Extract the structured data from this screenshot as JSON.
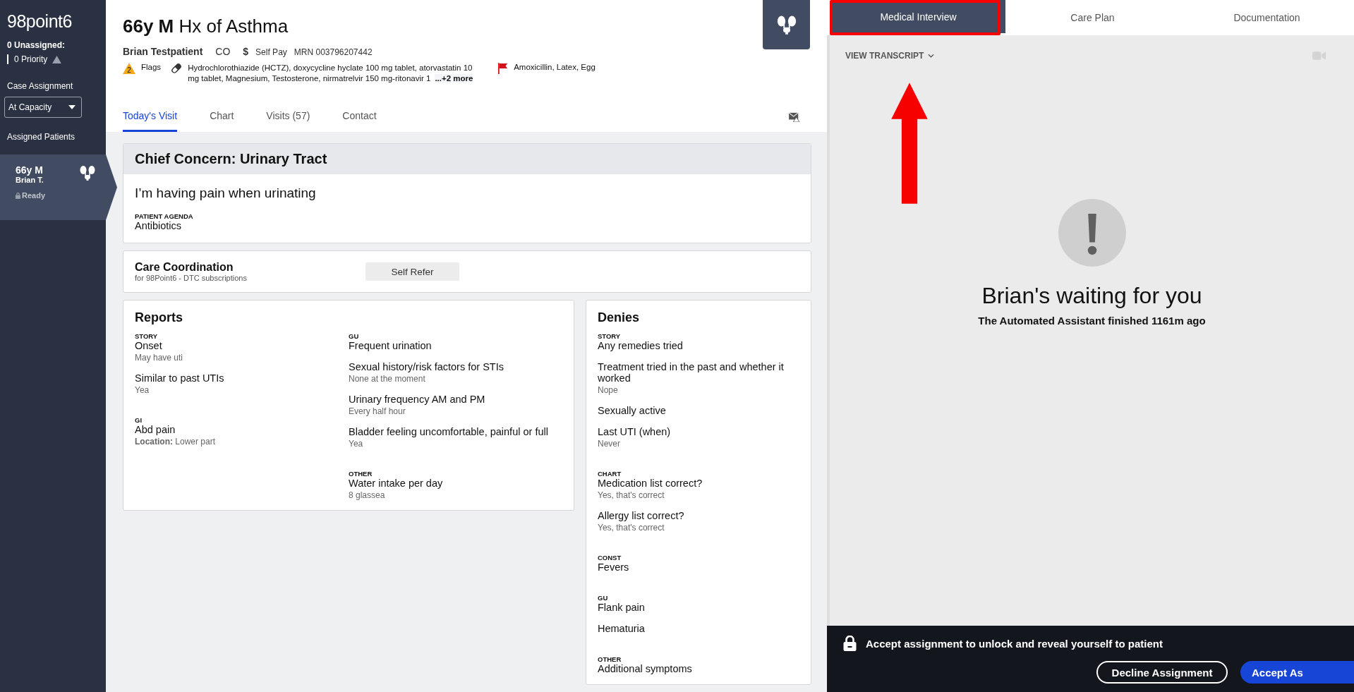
{
  "sidebar": {
    "logo": "98point6",
    "unassigned": "0 Unassigned:",
    "priority": "0 Priority",
    "case_assignment_label": "Case Assignment",
    "case_assignment_value": "At Capacity",
    "assigned_label": "Assigned Patients",
    "patients": [
      {
        "title": "66y M",
        "name": "Brian T.",
        "status": "Ready",
        "selected": true
      }
    ]
  },
  "header": {
    "title_bold": "66y M",
    "title_rest": "Hx of Asthma",
    "patient_name": "Brian Testpatient",
    "state": "CO",
    "payment_symbol": "$",
    "payment": "Self Pay",
    "mrn": "MRN 003796207442",
    "flags_count": "2",
    "flags_label": "Flags",
    "medications": "Hydrochlorothiazide (HCTZ), doxycycline hyclate 100 mg tablet, atorvastatin 10 mg tablet, Magnesium, Testosterone, nirmatrelvir 150 mg-ritonavir 1",
    "more": "...+2 more",
    "allergies": "Amoxicillin, Latex, Egg"
  },
  "tabs": [
    {
      "label": "Today's Visit",
      "selected": true
    },
    {
      "label": "Chart",
      "selected": false
    },
    {
      "label": "Visits (57)",
      "selected": false
    },
    {
      "label": "Contact",
      "selected": false
    }
  ],
  "chief_concern": {
    "heading": "Chief Concern:  Urinary Tract",
    "statement": "I’m having pain when urinating",
    "agenda_label": "PATIENT AGENDA",
    "agenda": "Antibiotics"
  },
  "care_coordination": {
    "title": "Care Coordination",
    "subtitle": "for 98Point6 - DTC subscriptions",
    "button": "Self Refer"
  },
  "reports": {
    "title": "Reports",
    "columns": [
      [
        {
          "label": "STORY",
          "items": [
            {
              "question": "Onset",
              "answer": "May have uti"
            },
            {
              "question": "Similar to past UTIs",
              "answer": "Yea"
            }
          ]
        },
        {
          "label": "GI",
          "items": [
            {
              "question": "Abd pain",
              "answer": "**Location:** Lower part"
            }
          ]
        }
      ],
      [
        {
          "label": "GU",
          "items": [
            {
              "question": "Frequent urination"
            },
            {
              "question": "Sexual history/risk factors for STIs",
              "answer": "None at the moment"
            },
            {
              "question": "Urinary frequency AM and PM",
              "answer": "Every half hour"
            },
            {
              "question": "Bladder feeling uncomfortable, painful or full",
              "answer": "Yea"
            }
          ]
        },
        {
          "label": "OTHER",
          "items": [
            {
              "question": "Water intake per day",
              "answer": "8 glassea"
            }
          ]
        }
      ]
    ]
  },
  "denies": {
    "title": "Denies",
    "groups": [
      {
        "label": "STORY",
        "items": [
          {
            "question": "Any remedies tried"
          },
          {
            "question": "Treatment tried in the past and whether it worked",
            "answer": "Nope"
          },
          {
            "question": "Sexually active"
          },
          {
            "question": "Last UTI (when)",
            "answer": "Never"
          }
        ]
      },
      {
        "label": "CHART",
        "items": [
          {
            "question": "Medication list correct?",
            "answer": "Yes, that's correct"
          },
          {
            "question": "Allergy list correct?",
            "answer": "Yes, that's correct"
          }
        ]
      },
      {
        "label": "CONST",
        "items": [
          {
            "question": "Fevers"
          }
        ]
      },
      {
        "label": "GU",
        "items": [
          {
            "question": "Flank pain"
          },
          {
            "question": "Hematuria"
          }
        ]
      },
      {
        "label": "OTHER",
        "items": [
          {
            "question": "Additional symptoms"
          }
        ]
      }
    ]
  },
  "right_panel": {
    "tabs": [
      {
        "label": "Medical Interview",
        "selected": true
      },
      {
        "label": "Care Plan",
        "selected": false
      },
      {
        "label": "Documentation",
        "selected": false
      }
    ],
    "transcript": "VIEW TRANSCRIPT",
    "waiting_title": "Brian's waiting for you",
    "waiting_subtitle": "The Automated Assistant finished 1161m ago",
    "lock_message": "Accept assignment to unlock and reveal yourself to patient",
    "buttons": [
      {
        "label": "Decline Assignment",
        "kind": "outline"
      },
      {
        "label": "Accept As",
        "kind": "primary"
      }
    ]
  }
}
